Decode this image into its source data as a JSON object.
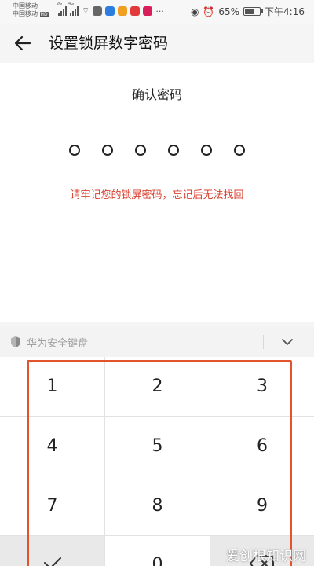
{
  "status_bar": {
    "carrier_1": "中国移动",
    "carrier_2": "中国移动",
    "hd": "HD",
    "net_1": "2G",
    "net_2": "4G",
    "battery_percent": "65%",
    "battery_level": 0.65,
    "time": "下午4:16"
  },
  "header": {
    "title": "设置锁屏数字密码"
  },
  "main": {
    "subtitle": "确认密码",
    "pin_length": 6,
    "warning": "请牢记您的锁屏密码，忘记后无法找回",
    "warning_color": "#d9412f"
  },
  "keyboard": {
    "label": "华为安全键盘",
    "keys": [
      "1",
      "2",
      "3",
      "4",
      "5",
      "6",
      "7",
      "8",
      "9",
      "",
      "0",
      ""
    ],
    "highlight_color": "#e3532c"
  },
  "watermark": "爱创根知识网"
}
